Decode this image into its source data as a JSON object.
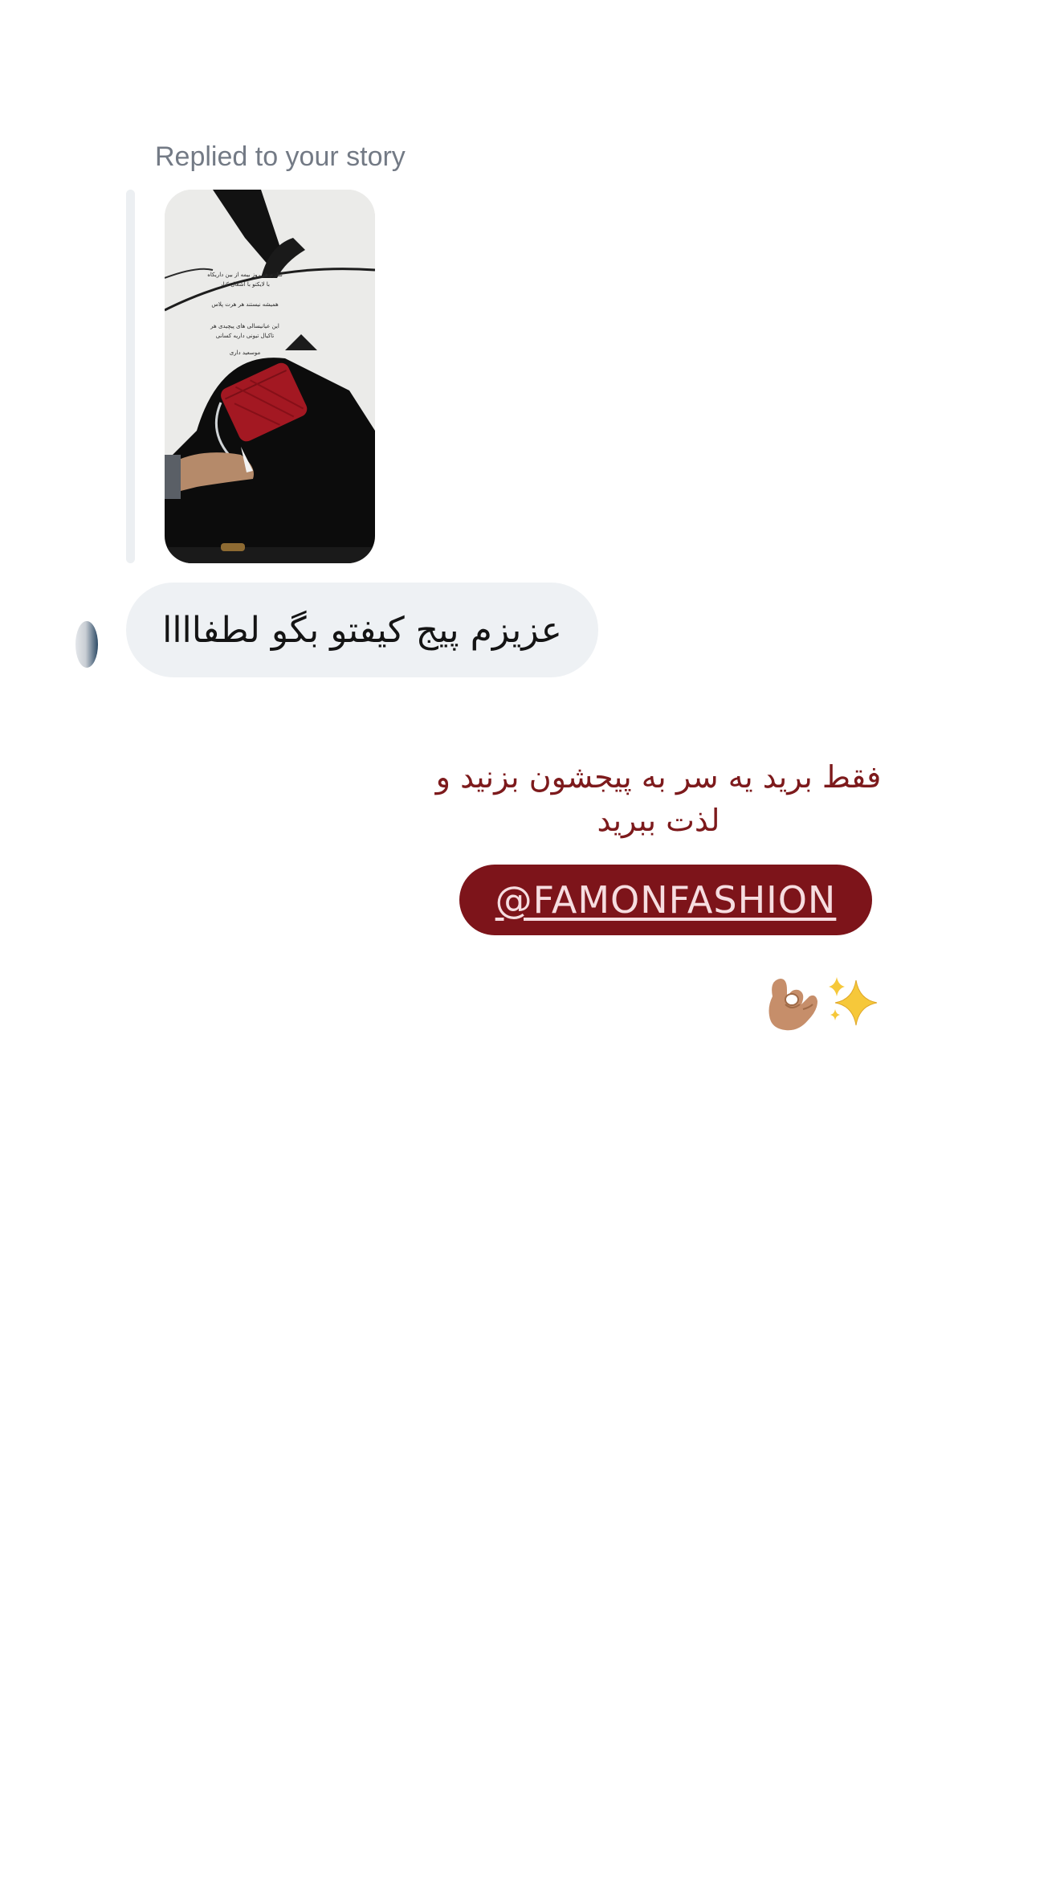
{
  "conversation": {
    "reply_context_label": "Replied to your story",
    "message_text": "عزیزم پیج کیفتو  بگو لطفاااا"
  },
  "story_preview": {
    "caption_lines": [
      "نظرم هر روز بیمه از بین داریکاه",
      "با لایکتو با آشغال کنار",
      "همیشه نیستند هر هرت پلاس",
      "این عیانیسالی های پیچیدی هر",
      "تاکیال تیونی داریه کسانی",
      "موسعید داری"
    ]
  },
  "reply_message": {
    "text_line_1": "فقط برید یه سر به پیجشون بزنید و",
    "text_line_2": "لذت ببرید",
    "mention": "@FAMONFASHION",
    "emoji_names": [
      "ok-hand-emoji",
      "sparkles-emoji"
    ]
  },
  "colors": {
    "bubble_bg": "#eef1f4",
    "label_gray": "#737a85",
    "reply_text": "#7d1a1c",
    "mention_bg": "#7d141a",
    "mention_text": "#f6dde0"
  }
}
